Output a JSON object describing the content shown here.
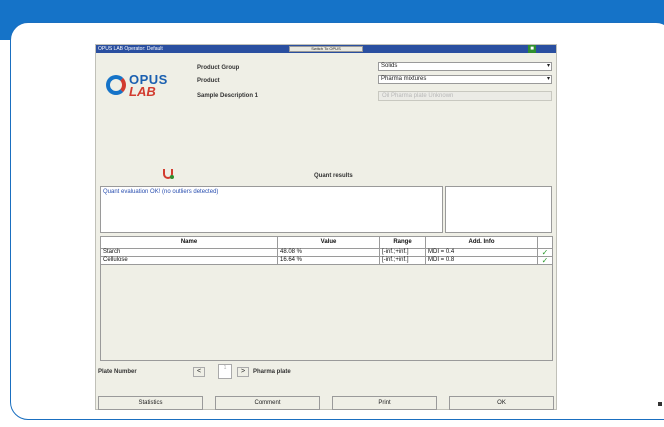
{
  "window": {
    "title": "OPUS LAB Operator: Default",
    "switch_label": "Switch To OPUS",
    "status_icon": "green-monitor-icon"
  },
  "logo": {
    "word1": "OPUS",
    "word2": "LAB"
  },
  "form": {
    "product_group_label": "Product Group",
    "product_group_value": "Solids",
    "product_label": "Product",
    "product_value": "Pharma mixtures",
    "sample_label": "Sample Description 1",
    "sample_value": "Oil Pharma plate Unknown"
  },
  "quant": {
    "title": "Quant results",
    "message": "Quant evaluation OK! (no outliers detected)"
  },
  "table": {
    "headers": [
      "Name",
      "Value",
      "Range",
      "Add. Info",
      ""
    ],
    "rows": [
      {
        "name": "Starch",
        "value": "48.08 %",
        "range": "[-inf.;+inf.]",
        "info": "MDI = 0.4",
        "ok": "✓"
      },
      {
        "name": "Cellulose",
        "value": "16.64 %",
        "range": "[-inf.;+inf.]",
        "info": "MDI = 0.8",
        "ok": "✓"
      }
    ]
  },
  "plate": {
    "label": "Plate Number",
    "prev": "<",
    "number": "1",
    "next": ">",
    "name": "Pharma plate"
  },
  "buttons": {
    "statistics": "Statistics",
    "comment": "Comment",
    "print": "Print",
    "ok": "OK"
  },
  "colors": {
    "brand_blue": "#1573c8",
    "brand_red": "#d23b2f",
    "check_green": "#2c9a2c"
  }
}
